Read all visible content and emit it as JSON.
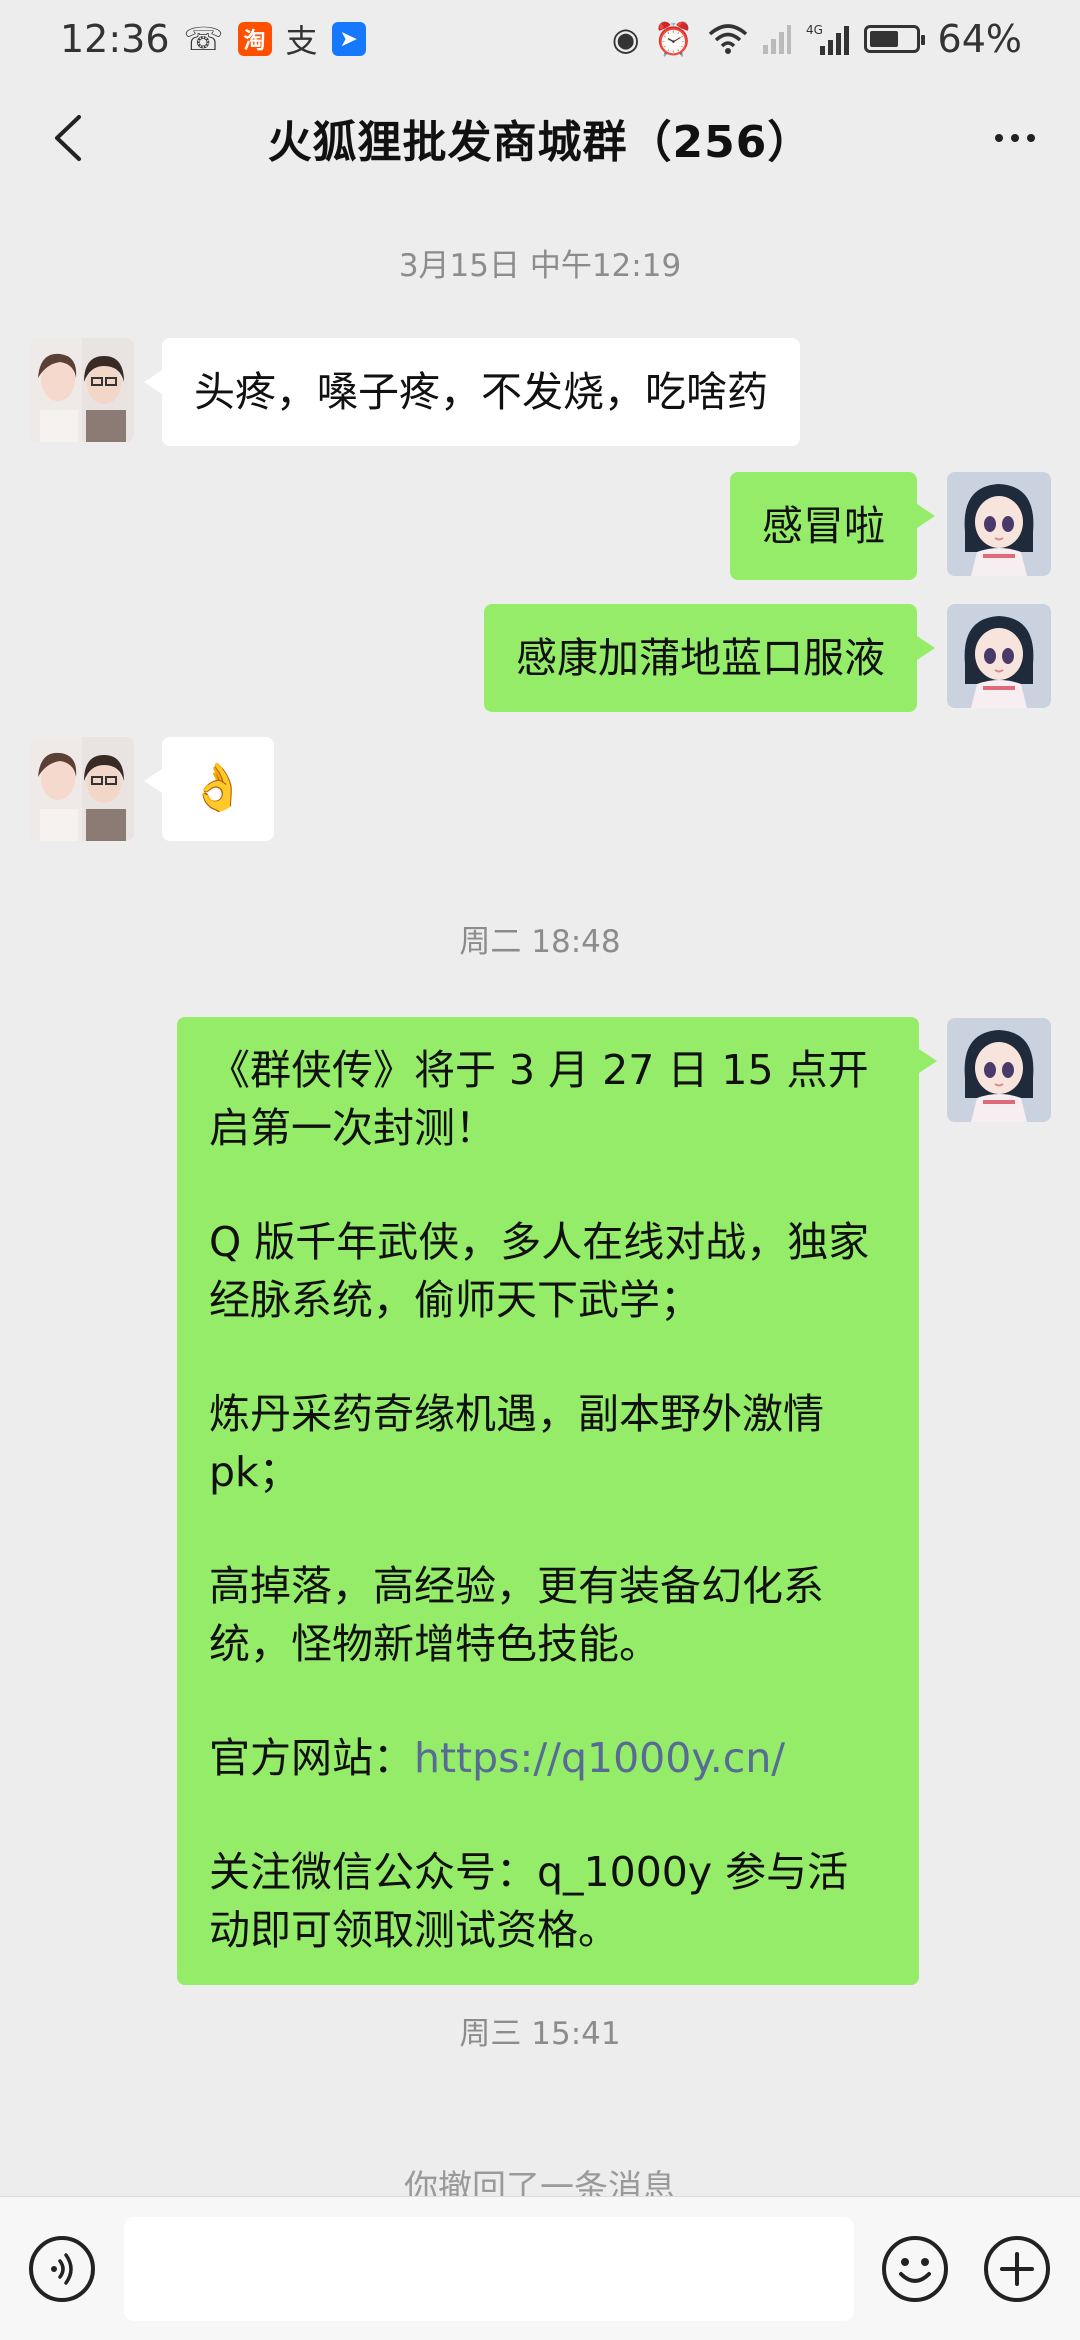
{
  "status_bar": {
    "time": "12:36",
    "app_icons": [
      "missed-call-icon",
      "taobao-icon",
      "alipay-icon",
      "blue-app-icon"
    ],
    "indicators": [
      "eye-icon",
      "alarm-icon",
      "wifi-icon",
      "signal-icon",
      "signal-4g-icon",
      "battery-icon"
    ],
    "battery_percent": "64%",
    "battery_level": 0.64
  },
  "header": {
    "title": "火狐狸批发商城群（256）"
  },
  "chat": {
    "timestamps": [
      "3月15日 中午12:19",
      "周二 18:48",
      "周三 15:41"
    ],
    "messages": [
      {
        "side": "left",
        "text": "头疼，嗓子疼，不发烧，吃啥药"
      },
      {
        "side": "right",
        "text": "感冒啦"
      },
      {
        "side": "right",
        "text": "感康加蒲地蓝口服液"
      },
      {
        "side": "left",
        "emoji": "👌"
      }
    ],
    "long_message": {
      "side": "right",
      "p1": "《群侠传》将于 3 月 27 日 15 点开启第一次封测！",
      "p2": "Q 版千年武侠，多人在线对战，独家经脉系统，偷师天下武学；",
      "p3": "炼丹采药奇缘机遇，副本野外激情 pk；",
      "p4": "高掉落，高经验，更有装备幻化系统，怪物新增特色技能。",
      "p5_label": "官方网站：",
      "p5_link": "https://q1000y.cn/",
      "p6": "关注微信公众号：q_1000y 参与活动即可领取测试资格。"
    },
    "recalled_notice": "你撤回了一条消息"
  },
  "input_bar": {
    "voice_icon": "voice-icon",
    "emoji_icon": "emoji-icon",
    "plus_icon": "plus-icon",
    "input_value": ""
  },
  "colors": {
    "background": "#ededed",
    "bubble_self": "#95ec69",
    "bubble_other": "#ffffff",
    "link": "#576b95"
  }
}
